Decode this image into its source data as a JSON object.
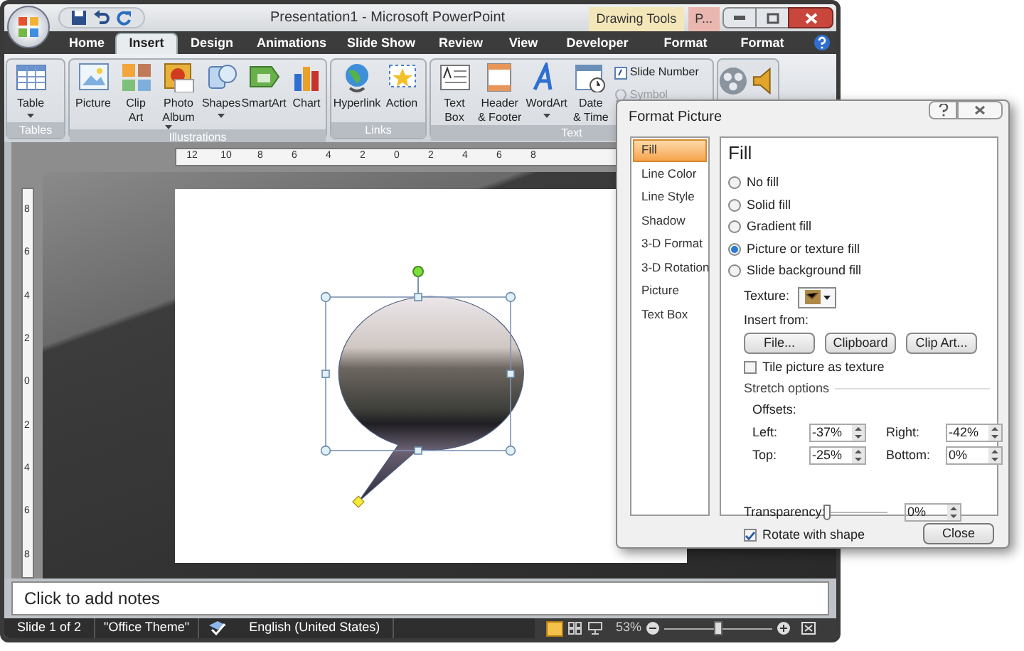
{
  "window": {
    "title": "Presentation1 - Microsoft PowerPoint",
    "contextual_tabs": [
      {
        "label": "Drawing Tools",
        "color": "#f3e6b8"
      },
      {
        "label": "P...",
        "color": "#e9b7b0"
      }
    ]
  },
  "ribbon_tabs": [
    {
      "label": "Home",
      "selected": false
    },
    {
      "label": "Insert",
      "selected": true
    },
    {
      "label": "Design",
      "selected": false
    },
    {
      "label": "Animations",
      "selected": false
    },
    {
      "label": "Slide Show",
      "selected": false
    },
    {
      "label": "Review",
      "selected": false
    },
    {
      "label": "View",
      "selected": false
    },
    {
      "label": "Developer",
      "selected": false
    },
    {
      "label": "Format",
      "selected": false
    },
    {
      "label": "Format",
      "selected": false
    }
  ],
  "ribbon_groups": [
    {
      "label": "Tables",
      "buttons": [
        {
          "kind": "table",
          "label": "Table",
          "menu": true
        }
      ]
    },
    {
      "label": "Illustrations",
      "buttons": [
        {
          "kind": "picture",
          "label": "Picture",
          "menu": false
        },
        {
          "kind": "clipart",
          "label": "Clip Art",
          "menu": false
        },
        {
          "kind": "album",
          "label": "Photo Album",
          "menu": true
        },
        {
          "kind": "shapes",
          "label": "Shapes",
          "menu": true
        },
        {
          "kind": "smartart",
          "label": "SmartArt",
          "menu": false
        },
        {
          "kind": "chart",
          "label": "Chart",
          "menu": false
        }
      ]
    },
    {
      "label": "Links",
      "buttons": [
        {
          "kind": "globe",
          "label": "Hyperlink",
          "menu": false
        },
        {
          "kind": "star",
          "label": "Action",
          "menu": false
        }
      ]
    },
    {
      "label": "Text",
      "buttons": [
        {
          "kind": "textbox",
          "label": "Text Box",
          "menu": false
        },
        {
          "kind": "header",
          "label": "Header & Footer",
          "menu": false
        },
        {
          "kind": "wordart",
          "label": "WordArt",
          "menu": true
        },
        {
          "kind": "calendar",
          "label": "Date & Time",
          "menu": false
        }
      ],
      "small_buttons": [
        {
          "label": "Slide Number",
          "disabled": false
        },
        {
          "label": "Symbol",
          "disabled": true
        }
      ]
    }
  ],
  "ruler": {
    "horizontal": [
      "12",
      "10",
      "8",
      "6",
      "4",
      "2",
      "0",
      "2",
      "4",
      "6",
      "8"
    ],
    "vertical": [
      "8",
      "6",
      "4",
      "2",
      "0",
      "2",
      "4",
      "6",
      "8"
    ]
  },
  "notes": {
    "placeholder": "Click to add notes"
  },
  "status_bar": {
    "slide": "Slide 1 of 2",
    "theme": "\"Office Theme\"",
    "language": "English (United States)",
    "zoom": "53%",
    "zoom_slider": {
      "level": 0.5
    }
  },
  "dialog": {
    "title": "Format Picture",
    "nav": [
      {
        "label": "Fill",
        "selected": true
      },
      {
        "label": "Line Color",
        "selected": false
      },
      {
        "label": "Line Style",
        "selected": false
      },
      {
        "label": "Shadow",
        "selected": false
      },
      {
        "label": "3-D Format",
        "selected": false
      },
      {
        "label": "3-D Rotation",
        "selected": false
      },
      {
        "label": "Picture",
        "selected": false
      },
      {
        "label": "Text Box",
        "selected": false
      }
    ],
    "heading": "Fill",
    "fill_options": [
      {
        "label": "No fill",
        "selected": false
      },
      {
        "label": "Solid fill",
        "selected": false
      },
      {
        "label": "Gradient fill",
        "selected": false
      },
      {
        "label": "Picture or texture fill",
        "selected": true
      },
      {
        "label": "Slide background fill",
        "selected": false
      }
    ],
    "texture_label": "Texture:",
    "insert_from": "Insert from:",
    "insert_buttons": [
      "File...",
      "Clipboard",
      "Clip Art..."
    ],
    "tile": {
      "label": "Tile picture as texture",
      "checked": false
    },
    "stretch_options": "Stretch options",
    "offsets_label": "Offsets:",
    "offsets": [
      {
        "label": "Left:",
        "value": "-37%"
      },
      {
        "label": "Right:",
        "value": "-42%"
      },
      {
        "label": "Top:",
        "value": "-25%"
      },
      {
        "label": "Bottom:",
        "value": "0%"
      }
    ],
    "transparency": {
      "label": "Transparency:",
      "level": 0,
      "value": "0%"
    },
    "rotate": {
      "label": "Rotate with shape",
      "checked": true
    },
    "close": "Close"
  }
}
